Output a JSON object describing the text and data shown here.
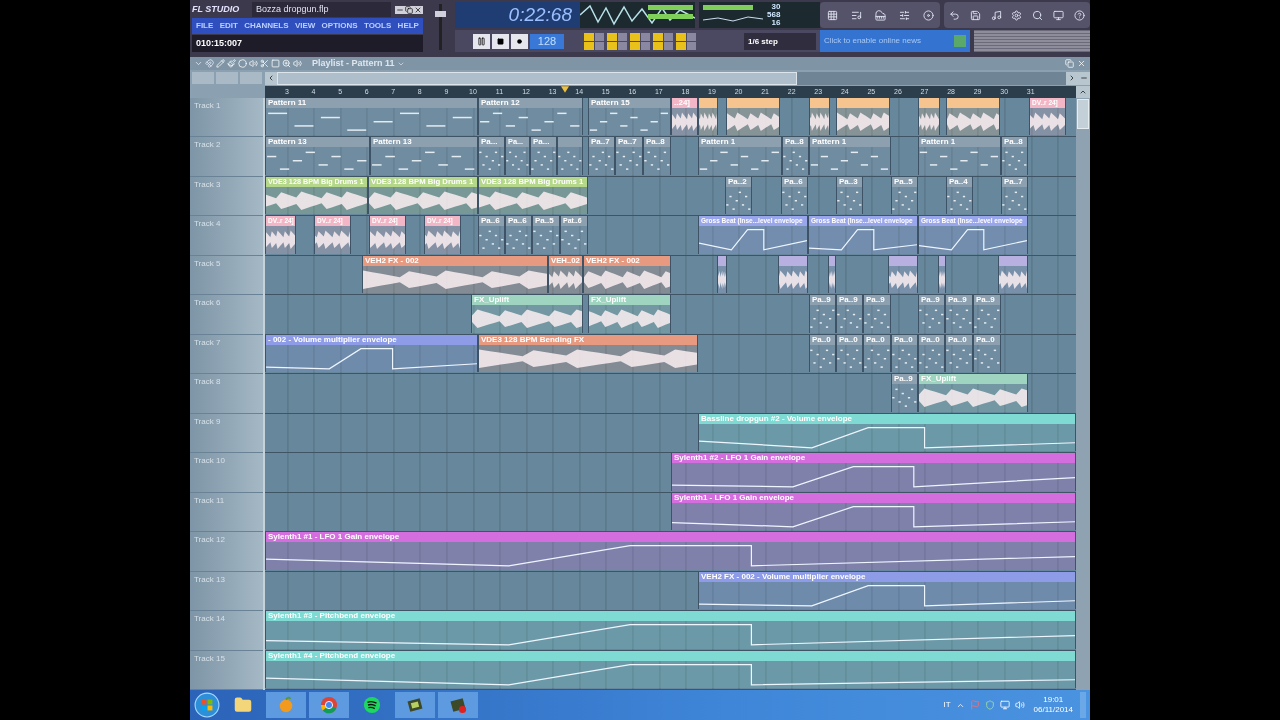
{
  "app": {
    "logo": "FL STUDIO",
    "file_name": "Bozza dropgun.flp",
    "menu": [
      "FILE",
      "EDIT",
      "CHANNELS",
      "VIEW",
      "OPTIONS",
      "TOOLS",
      "HELP"
    ],
    "hint": "010:15:007"
  },
  "transport": {
    "time": "0:22:68",
    "tempo": "128"
  },
  "master_volume": {
    "level": 0.82
  },
  "monitor": {
    "readouts": [
      "30",
      "568",
      "16"
    ]
  },
  "snap": "1/6 step",
  "news": "Click to enable online news",
  "playlist": {
    "title": "Playlist - Pattern 11",
    "ruler": [
      "3",
      "4",
      "5",
      "6",
      "7",
      "8",
      "9",
      "10",
      "11",
      "12",
      "13",
      "14",
      "15",
      "16",
      "17",
      "18",
      "19",
      "20",
      "21",
      "22",
      "23",
      "24",
      "25",
      "26",
      "27",
      "28",
      "29",
      "30",
      "31"
    ],
    "tracks": [
      {
        "name": "Track 1",
        "clips": [
          {
            "label": "Pattern 11",
            "color": "#8da0b0",
            "kind": "pattern"
          },
          {
            "label": "Pattern 12",
            "color": "#8da0b0",
            "kind": "pattern"
          },
          {
            "label": "Pattern 15",
            "color": "#8da0b0",
            "kind": "pattern"
          },
          {
            "label": "..24]",
            "color": "#f2b6c6",
            "kind": "audio"
          },
          {
            "color": "#f6c48e",
            "kind": "audio"
          },
          {
            "color": "#f6c48e",
            "kind": "audio"
          },
          {
            "color": "#f6c48e",
            "kind": "audio"
          },
          {
            "color": "#f6c48e",
            "kind": "audio"
          },
          {
            "color": "#f6c48e",
            "kind": "audio"
          },
          {
            "color": "#f6c48e",
            "kind": "audio"
          },
          {
            "label": "DV..r 24]",
            "color": "#f2b6c6",
            "kind": "audio"
          }
        ]
      },
      {
        "name": "Track 2",
        "clips": [
          {
            "label": "Pattern 13",
            "color": "#8da0b0",
            "kind": "pattern"
          },
          {
            "label": "Pattern 13",
            "color": "#8da0b0",
            "kind": "pattern"
          },
          {
            "label": "Pa...",
            "color": "#8da0b0",
            "kind": "pattern"
          },
          {
            "label": "Pa...",
            "color": "#8da0b0",
            "kind": "pattern"
          },
          {
            "label": "Pa...",
            "color": "#8da0b0",
            "kind": "pattern"
          },
          {
            "color": "#8da0b0",
            "kind": "pattern"
          },
          {
            "label": "Pa..7",
            "color": "#8da0b0",
            "kind": "pattern"
          },
          {
            "label": "Pa..7",
            "color": "#8da0b0",
            "kind": "pattern"
          },
          {
            "label": "Pa..8",
            "color": "#8da0b0",
            "kind": "pattern"
          },
          {
            "label": "Pattern 1",
            "color": "#8da0b0",
            "kind": "pattern"
          },
          {
            "label": "Pa..8",
            "color": "#8da0b0",
            "kind": "pattern"
          },
          {
            "label": "Pattern 1",
            "color": "#8da0b0",
            "kind": "pattern"
          },
          {
            "label": "Pattern 1",
            "color": "#8da0b0",
            "kind": "pattern"
          },
          {
            "label": "Pa..8",
            "color": "#8da0b0",
            "kind": "pattern"
          }
        ]
      },
      {
        "name": "Track 3",
        "clips": [
          {
            "label": "VDE3 128 BPM Big Drums 1",
            "color": "#b4d78a",
            "kind": "audio"
          },
          {
            "label": "VDE3 128 BPM Big Drums 1",
            "color": "#b4d78a",
            "kind": "audio"
          },
          {
            "label": "VDE3 128 BPM Big Drums 1",
            "color": "#b4d78a",
            "kind": "audio"
          },
          {
            "label": "Pa..2",
            "color": "#8da0b0",
            "kind": "pattern"
          },
          {
            "label": "Pa..6",
            "color": "#8da0b0",
            "kind": "pattern"
          },
          {
            "label": "Pa..3",
            "color": "#8da0b0",
            "kind": "pattern"
          },
          {
            "label": "Pa..5",
            "color": "#8da0b0",
            "kind": "pattern"
          },
          {
            "label": "Pa..4",
            "color": "#8da0b0",
            "kind": "pattern"
          },
          {
            "label": "Pa..7",
            "color": "#8da0b0",
            "kind": "pattern"
          }
        ]
      },
      {
        "name": "Track 4",
        "clips": [
          {
            "label": "DV..r 24]",
            "color": "#f2b6c6",
            "kind": "audio"
          },
          {
            "label": "DV..r 24]",
            "color": "#f2b6c6",
            "kind": "audio"
          },
          {
            "label": "DV..r 24]",
            "color": "#f2b6c6",
            "kind": "audio"
          },
          {
            "label": "DV..r 24]",
            "color": "#f2b6c6",
            "kind": "audio"
          },
          {
            "label": "Pa..6",
            "color": "#8da0b0",
            "kind": "pattern"
          },
          {
            "label": "Pa..6",
            "color": "#8da0b0",
            "kind": "pattern"
          },
          {
            "label": "Pa..5",
            "color": "#8da0b0",
            "kind": "pattern"
          },
          {
            "label": "Pat..6",
            "color": "#8da0b0",
            "kind": "pattern"
          },
          {
            "label": "Gross Beat (Inse...level envelope",
            "color": "#9aa6ec",
            "kind": "automation"
          },
          {
            "label": "Gross Beat (Inse...level envelope",
            "color": "#9aa6ec",
            "kind": "automation"
          },
          {
            "label": "Gross Beat (Inse...level envelope",
            "color": "#9aa6ec",
            "kind": "automation"
          }
        ]
      },
      {
        "name": "Track 5",
        "clips": [
          {
            "label": "VEH2 FX - 002",
            "color": "#e89a80",
            "kind": "audio"
          },
          {
            "label": "VEH..02",
            "color": "#e89a80",
            "kind": "audio"
          },
          {
            "label": "VEH2 FX - 002",
            "color": "#e89a80",
            "kind": "audio"
          },
          {
            "color": "#b8b0e0",
            "kind": "audio"
          },
          {
            "color": "#b8b0e0",
            "kind": "audio"
          },
          {
            "color": "#b8b0e0",
            "kind": "audio"
          },
          {
            "color": "#b8b0e0",
            "kind": "audio"
          },
          {
            "color": "#b8b0e0",
            "kind": "audio"
          },
          {
            "color": "#b8b0e0",
            "kind": "audio"
          }
        ]
      },
      {
        "name": "Track 6",
        "clips": [
          {
            "label": "FX_Uplift",
            "color": "#9fd4c0",
            "kind": "audio"
          },
          {
            "label": "FX_Uplift",
            "color": "#9fd4c0",
            "kind": "audio"
          },
          {
            "label": "Pa..9",
            "color": "#8da0b0",
            "kind": "pattern"
          },
          {
            "label": "Pa..9",
            "color": "#8da0b0",
            "kind": "pattern"
          },
          {
            "label": "Pa..9",
            "color": "#8da0b0",
            "kind": "pattern"
          },
          {
            "label": "Pa..9",
            "color": "#8da0b0",
            "kind": "pattern"
          },
          {
            "label": "Pa..9",
            "color": "#8da0b0",
            "kind": "pattern"
          },
          {
            "label": "Pa..9",
            "color": "#8da0b0",
            "kind": "pattern"
          }
        ]
      },
      {
        "name": "Track 7",
        "clips": [
          {
            "label": "- 002 - Volume multiplier envelope",
            "color": "#8e9ce8",
            "kind": "automation"
          },
          {
            "label": "VDE3 128 BPM Bending FX",
            "color": "#e89a80",
            "kind": "audio"
          },
          {
            "label": "Pa..0",
            "color": "#8da0b0",
            "kind": "pattern"
          },
          {
            "label": "Pa..0",
            "color": "#8da0b0",
            "kind": "pattern"
          },
          {
            "label": "Pa..0",
            "color": "#8da0b0",
            "kind": "pattern"
          },
          {
            "label": "Pa..0",
            "color": "#8da0b0",
            "kind": "pattern"
          },
          {
            "label": "Pa..0",
            "color": "#8da0b0",
            "kind": "pattern"
          },
          {
            "label": "Pa..0",
            "color": "#8da0b0",
            "kind": "pattern"
          },
          {
            "label": "Pa..0",
            "color": "#8da0b0",
            "kind": "pattern"
          }
        ]
      },
      {
        "name": "Track 8",
        "clips": [
          {
            "label": "Pa..9",
            "color": "#8da0b0",
            "kind": "pattern"
          },
          {
            "label": "FX_Uplift",
            "color": "#9fd4c0",
            "kind": "audio"
          }
        ]
      },
      {
        "name": "Track 9",
        "clips": [
          {
            "label": "Bassline dropgun #2 - Volume envelope",
            "color": "#7edad2",
            "kind": "automation"
          }
        ]
      },
      {
        "name": "Track 10",
        "clips": [
          {
            "label": "Sylenth1 #2 - LFO 1 Gain envelope",
            "color": "#d46ede",
            "kind": "automation"
          }
        ]
      },
      {
        "name": "Track 11",
        "clips": [
          {
            "label": "Sylenth1 - LFO 1 Gain envelope",
            "color": "#d46ede",
            "kind": "automation"
          }
        ]
      },
      {
        "name": "Track 12",
        "clips": [
          {
            "label": "Sylenth1 #1 - LFO 1 Gain envelope",
            "color": "#d46ede",
            "kind": "automation"
          }
        ]
      },
      {
        "name": "Track 13",
        "clips": [
          {
            "label": "VEH2 FX - 002 - Volume multiplier envelope",
            "color": "#8e9ce8",
            "kind": "automation"
          }
        ]
      },
      {
        "name": "Track 14",
        "clips": [
          {
            "label": "Sylenth1 #3 - Pitchbend envelope",
            "color": "#7edad2",
            "kind": "automation"
          }
        ]
      },
      {
        "name": "Track 15",
        "clips": [
          {
            "label": "Sylenth1 #4 - Pitchbend envelope",
            "color": "#7edad2",
            "kind": "automation"
          }
        ]
      }
    ]
  },
  "taskbar": {
    "language": "IT",
    "time": "19:01",
    "date": "06/11/2014"
  }
}
